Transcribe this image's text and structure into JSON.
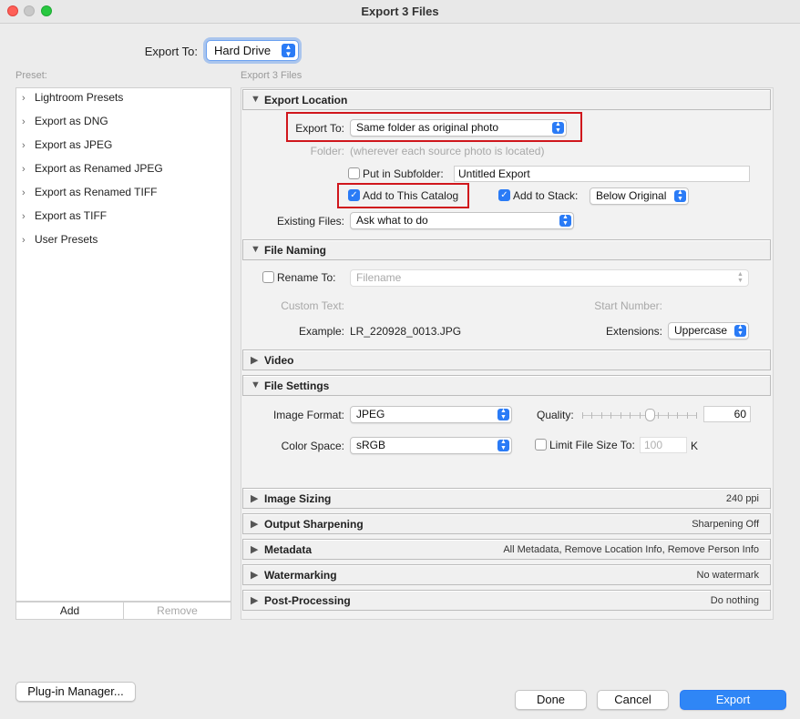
{
  "window": {
    "title": "Export 3 Files"
  },
  "export_to": {
    "label": "Export To:",
    "value": "Hard Drive"
  },
  "preset": {
    "label": "Preset:",
    "items": [
      "Lightroom Presets",
      "Export as DNG",
      "Export as JPEG",
      "Export as Renamed JPEG",
      "Export as Renamed TIFF",
      "Export as TIFF",
      "User Presets"
    ],
    "add_label": "Add",
    "remove_label": "Remove"
  },
  "panel_header": "Export 3 Files",
  "export_location": {
    "title": "Export Location",
    "export_to_label": "Export To:",
    "export_to_value": "Same folder as original photo",
    "folder_label": "Folder:",
    "folder_value": "(wherever each source photo is located)",
    "subfolder_label": "Put in Subfolder:",
    "subfolder_value": "Untitled Export",
    "subfolder_checked": false,
    "add_catalog_label": "Add to This Catalog",
    "add_catalog_checked": true,
    "add_stack_label": "Add to Stack:",
    "add_stack_checked": true,
    "stack_value": "Below Original",
    "existing_files_label": "Existing Files:",
    "existing_files_value": "Ask what to do"
  },
  "file_naming": {
    "title": "File Naming",
    "rename_label": "Rename To:",
    "rename_checked": false,
    "rename_value": "Filename",
    "custom_text_label": "Custom Text:",
    "start_number_label": "Start Number:",
    "example_label": "Example:",
    "example_value": "LR_220928_0013.JPG",
    "extensions_label": "Extensions:",
    "extensions_value": "Uppercase"
  },
  "video": {
    "title": "Video"
  },
  "file_settings": {
    "title": "File Settings",
    "image_format_label": "Image Format:",
    "image_format_value": "JPEG",
    "quality_label": "Quality:",
    "quality_value": "60",
    "quality_fraction": 0.6,
    "color_space_label": "Color Space:",
    "color_space_value": "sRGB",
    "limit_size_label": "Limit File Size To:",
    "limit_size_checked": false,
    "limit_size_value": "100",
    "limit_size_unit": "K"
  },
  "collapsed_sections": [
    {
      "title": "Image Sizing",
      "summary": "240 ppi"
    },
    {
      "title": "Output Sharpening",
      "summary": "Sharpening Off"
    },
    {
      "title": "Metadata",
      "summary": "All Metadata, Remove Location Info, Remove Person Info"
    },
    {
      "title": "Watermarking",
      "summary": "No watermark"
    },
    {
      "title": "Post-Processing",
      "summary": "Do nothing"
    }
  ],
  "buttons": {
    "plugin_manager": "Plug-in Manager...",
    "done": "Done",
    "cancel": "Cancel",
    "export": "Export"
  },
  "icons": {
    "expanded": "▼",
    "collapsed": "▶",
    "chevron": "›",
    "check": "✓",
    "stepper_up": "▲",
    "stepper_down": "▼"
  },
  "colors": {
    "accent": "#2a7bf6",
    "highlight_box": "#d0161c",
    "close": "#fe5f57",
    "minimize": "#c8c8c8",
    "zoom": "#28c840"
  }
}
